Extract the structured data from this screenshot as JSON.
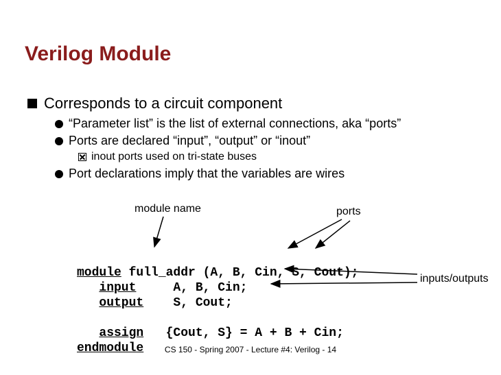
{
  "title": "Verilog Module",
  "bullets": {
    "l1": "Corresponds to a circuit component",
    "l2a": "“Parameter list” is the list of external connections, aka “ports”",
    "l2b": "Ports are declared “input”, “output” or “inout”",
    "l3a": "inout ports used on tri-state buses",
    "l2c": "Port declarations imply that the variables are wires"
  },
  "annotations": {
    "module_name": "module name",
    "ports": "ports",
    "inputs_outputs": "inputs/outputs"
  },
  "code": {
    "kw_module": "module",
    "name": " full_addr (A, B, Cin, S, Cout);",
    "kw_input": "input",
    "input_ports": "     A, B, Cin;",
    "kw_output": "output",
    "output_ports": "    S, Cout;",
    "kw_assign": "assign",
    "assign_expr": "   {Cout, S} = A + B + Cin;",
    "kw_endmodule": "endmodule"
  },
  "footer": "CS 150 - Spring 2007 - Lecture #4: Verilog - 14"
}
